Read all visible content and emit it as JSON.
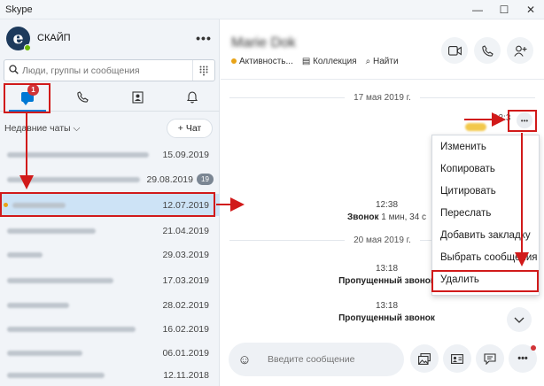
{
  "window": {
    "title": "Skype",
    "controls": [
      "—",
      "☐",
      "✕"
    ]
  },
  "profile": {
    "name": "СКАЙП",
    "avatar_letter": "e",
    "more": "•••"
  },
  "search": {
    "placeholder": "Люди, группы и сообщения",
    "icon": "search-icon",
    "dialpad_icon": "dialpad-icon"
  },
  "nav_tabs": [
    {
      "name": "chats",
      "icon": "chat-icon",
      "badge": "1",
      "active": true
    },
    {
      "name": "calls",
      "icon": "phone-icon",
      "glyph": "✆"
    },
    {
      "name": "contacts",
      "icon": "contacts-icon",
      "glyph": "▣"
    },
    {
      "name": "notifications",
      "icon": "bell-icon",
      "glyph": "🔔"
    }
  ],
  "recent": {
    "label": "Недавние чаты ⌵",
    "new_chat": "+ Чат"
  },
  "conversations": [
    {
      "date": "15.09.2019"
    },
    {
      "date": "29.08.2019",
      "unread": "19"
    },
    {
      "date": "12.07.2019",
      "selected": true
    },
    {
      "date": "21.04.2019"
    },
    {
      "date": "29.03.2019"
    },
    {
      "date": "17.03.2019"
    },
    {
      "date": "28.02.2019"
    },
    {
      "date": "16.02.2019"
    },
    {
      "date": "06.01.2019"
    },
    {
      "date": "12.11.2018"
    }
  ],
  "chat": {
    "name": "Marie Dok",
    "status": "Активность...",
    "gallery": "Коллекция",
    "find": "Найти",
    "header_icons": [
      "video-icon",
      "phone-icon",
      "add-person-icon"
    ]
  },
  "messages": {
    "date1": "17 мая 2019 г.",
    "time_partial": "12:3",
    "call_time": "12:38",
    "call_text_bold": "Звонок",
    "call_text_rest": " 1 мин, 34 с",
    "date2": "20 мая 2019 г.",
    "missed1_time": "13:18",
    "missed1_text": "Пропущенный звонок",
    "missed2_time": "13:18",
    "missed2_text": "Пропущенный звонок"
  },
  "context_menu": [
    "Изменить",
    "Копировать",
    "Цитировать",
    "Переслать",
    "Добавить закладку",
    "Выбрать сообщения",
    "Удалить"
  ],
  "composer": {
    "placeholder": "Введите сообщение",
    "icons": [
      "emoji-icon",
      "gallery-icon",
      "contact-card-icon",
      "chat-bubble-icon",
      "more-icon"
    ],
    "more": "•••"
  },
  "colors": {
    "accent": "#0078d4",
    "annotation": "#d11a1a",
    "badge": "#d13438"
  }
}
